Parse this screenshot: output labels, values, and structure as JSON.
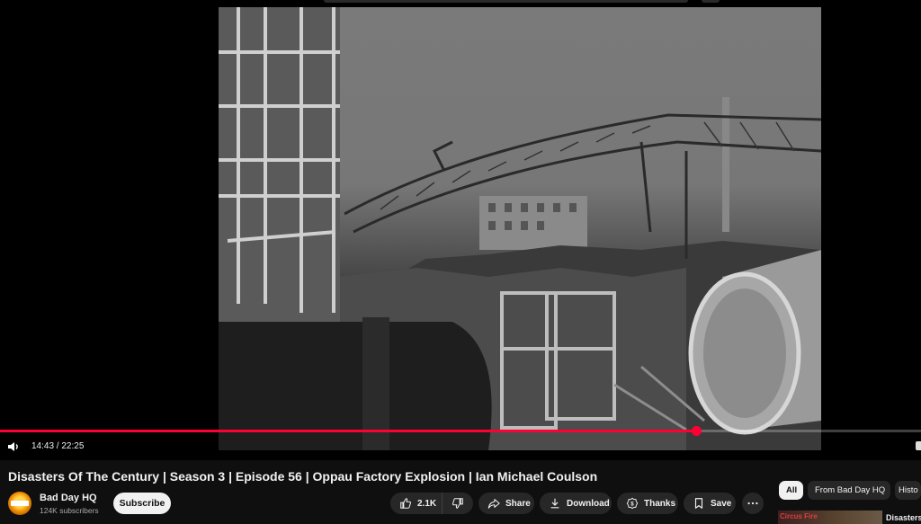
{
  "player": {
    "current_time": "14:43",
    "separator": " / ",
    "duration": "22:25",
    "progress": 0.756
  },
  "video": {
    "title": "Disasters Of The Century | Season 3 | Episode 56 | Oppau Factory Explosion | Ian Michael Coulson"
  },
  "channel": {
    "name": "Bad Day HQ",
    "subscribers": "124K subscribers",
    "subscribe_label": "Subscribe"
  },
  "actions": {
    "like_count": "2.1K",
    "share_label": "Share",
    "download_label": "Download",
    "thanks_label": "Thanks",
    "save_label": "Save"
  },
  "chips": [
    {
      "label": "All",
      "active": true
    },
    {
      "label": "From Bad Day HQ",
      "active": false
    },
    {
      "label": "Histo",
      "active": false
    }
  ],
  "recommended": {
    "thumb_text": "Circus Fire",
    "title": "Disasters"
  },
  "colors": {
    "accent": "#ff0033",
    "background": "#0f0f0f",
    "chip_bg": "#272727"
  },
  "icons": [
    "volume-icon",
    "thumbs-up-icon",
    "thumbs-down-icon",
    "share-icon",
    "download-icon",
    "thanks-icon",
    "save-icon",
    "more-icon"
  ]
}
